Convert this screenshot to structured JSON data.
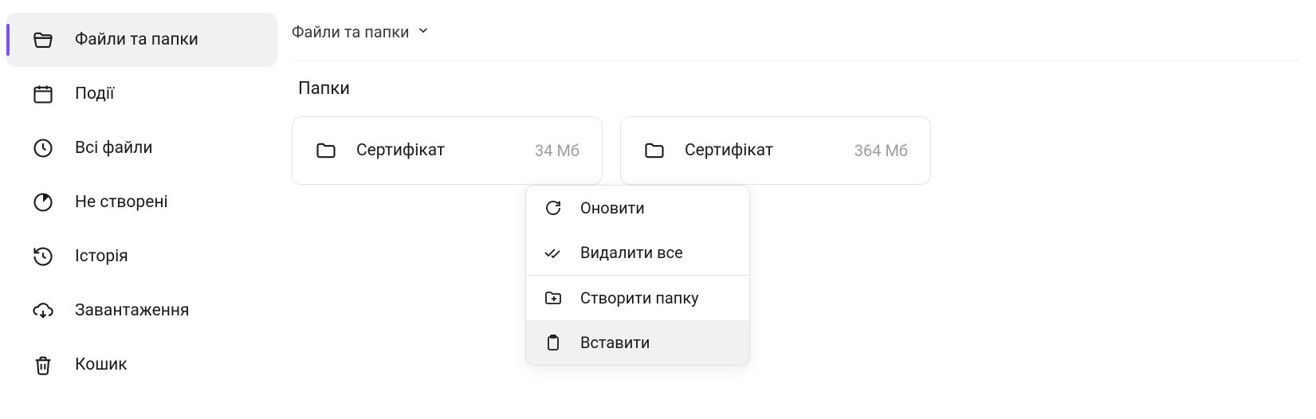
{
  "sidebar": {
    "items": [
      {
        "label": "Файли та папки",
        "icon": "folder-open",
        "active": true
      },
      {
        "label": "Події",
        "icon": "calendar",
        "active": false
      },
      {
        "label": "Всі файли",
        "icon": "clock",
        "active": false
      },
      {
        "label": "Не створені",
        "icon": "pie",
        "active": false
      },
      {
        "label": "Історія",
        "icon": "history",
        "active": false
      },
      {
        "label": "Завантаження",
        "icon": "cloud-download",
        "active": false
      },
      {
        "label": "Кошик",
        "icon": "trash",
        "active": false
      }
    ]
  },
  "breadcrumb": {
    "title": "Файли та папки"
  },
  "section": {
    "title": "Папки"
  },
  "folders": [
    {
      "name": "Сертифікат",
      "size": "34 Мб"
    },
    {
      "name": "Сертифікат",
      "size": "364 Мб"
    }
  ],
  "context_menu": {
    "items": [
      {
        "label": "Оновити",
        "icon": "refresh"
      },
      {
        "label": "Видалити все",
        "icon": "check-all"
      },
      {
        "label": "Створити папку",
        "icon": "folder-plus"
      },
      {
        "label": "Вставити",
        "icon": "paste",
        "hover": true
      }
    ]
  }
}
